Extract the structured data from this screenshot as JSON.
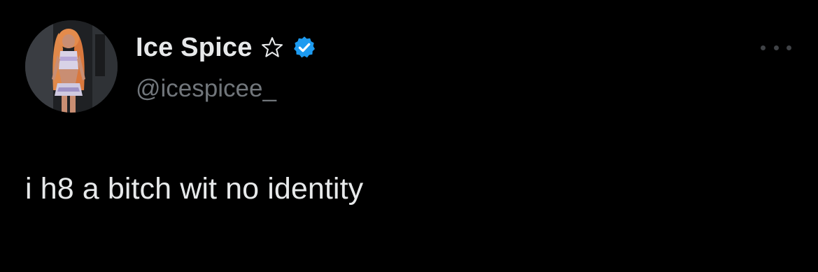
{
  "tweet": {
    "author": {
      "display_name": "Ice Spice",
      "handle": "@icespicee_",
      "name_emoji_icon": "star-outline-icon",
      "verified_icon": "verified-badge-icon",
      "verified_color": "#1d9bf0"
    },
    "text": "i h8 a bitch wit no identity",
    "more_icon": "more-horizontal-icon"
  },
  "colors": {
    "background": "#000000",
    "primary_text": "#e7e9ea",
    "secondary_text": "#71767b"
  }
}
